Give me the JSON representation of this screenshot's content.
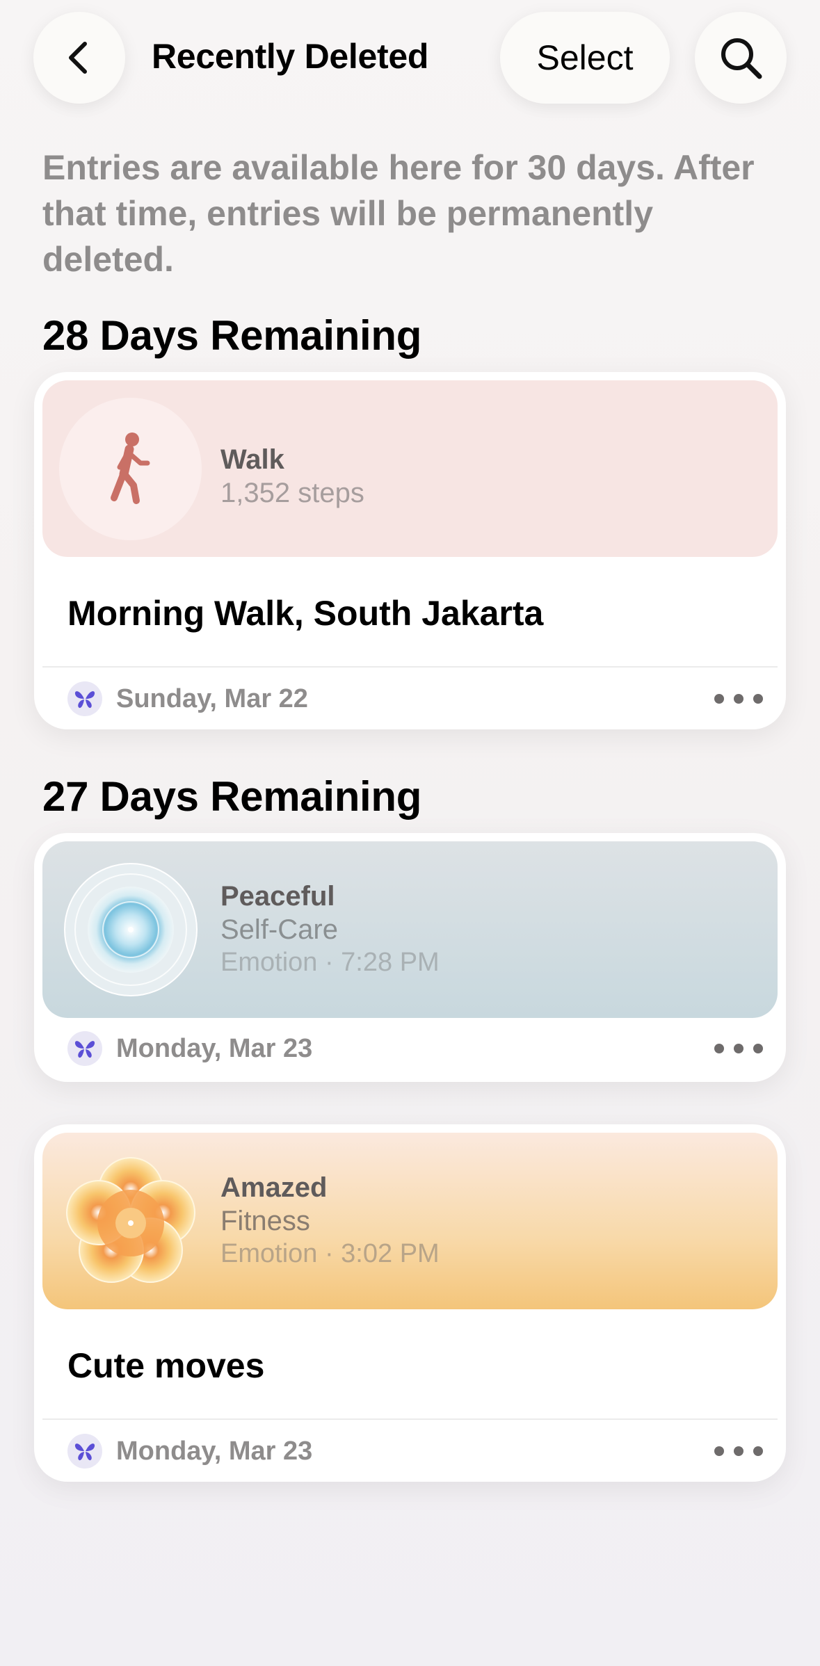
{
  "header": {
    "title": "Recently Deleted",
    "select_label": "Select",
    "back_icon": "chevron-left-icon",
    "search_icon": "search-icon"
  },
  "intro_text": "Entries are available here for 30 days. After that time, entries will be permanently deleted.",
  "sections": [
    {
      "title": "28 Days Remaining",
      "entries": [
        {
          "hero_title": "Walk",
          "hero_sub": "1,352 steps",
          "note": "Morning Walk, South Jakarta",
          "date": "Sunday, Mar 22",
          "icon": "walking-person-icon",
          "hero_color": "#f7e5e3"
        }
      ]
    },
    {
      "title": "27 Days Remaining",
      "entries": [
        {
          "hero_title": "Peaceful",
          "hero_sub": "Self-Care",
          "hero_meta": "Emotion · 7:28 PM",
          "date": "Monday, Mar 23",
          "icon": "peaceful-emotion-icon",
          "hero_color": "#cfdce1"
        },
        {
          "hero_title": "Amazed",
          "hero_sub": "Fitness",
          "hero_meta": "Emotion · 3:02 PM",
          "note": "Cute moves",
          "date": "Monday, Mar 23",
          "icon": "amazed-flower-icon",
          "hero_color": "#f7d29a"
        }
      ]
    }
  ],
  "footer_app_icon": "butterfly-icon",
  "more_icon": "ellipsis-icon",
  "colors": {
    "accent_purple": "#5b4fd6",
    "walk_figure": "#c97066",
    "secondary_text": "#8e8c8c"
  }
}
